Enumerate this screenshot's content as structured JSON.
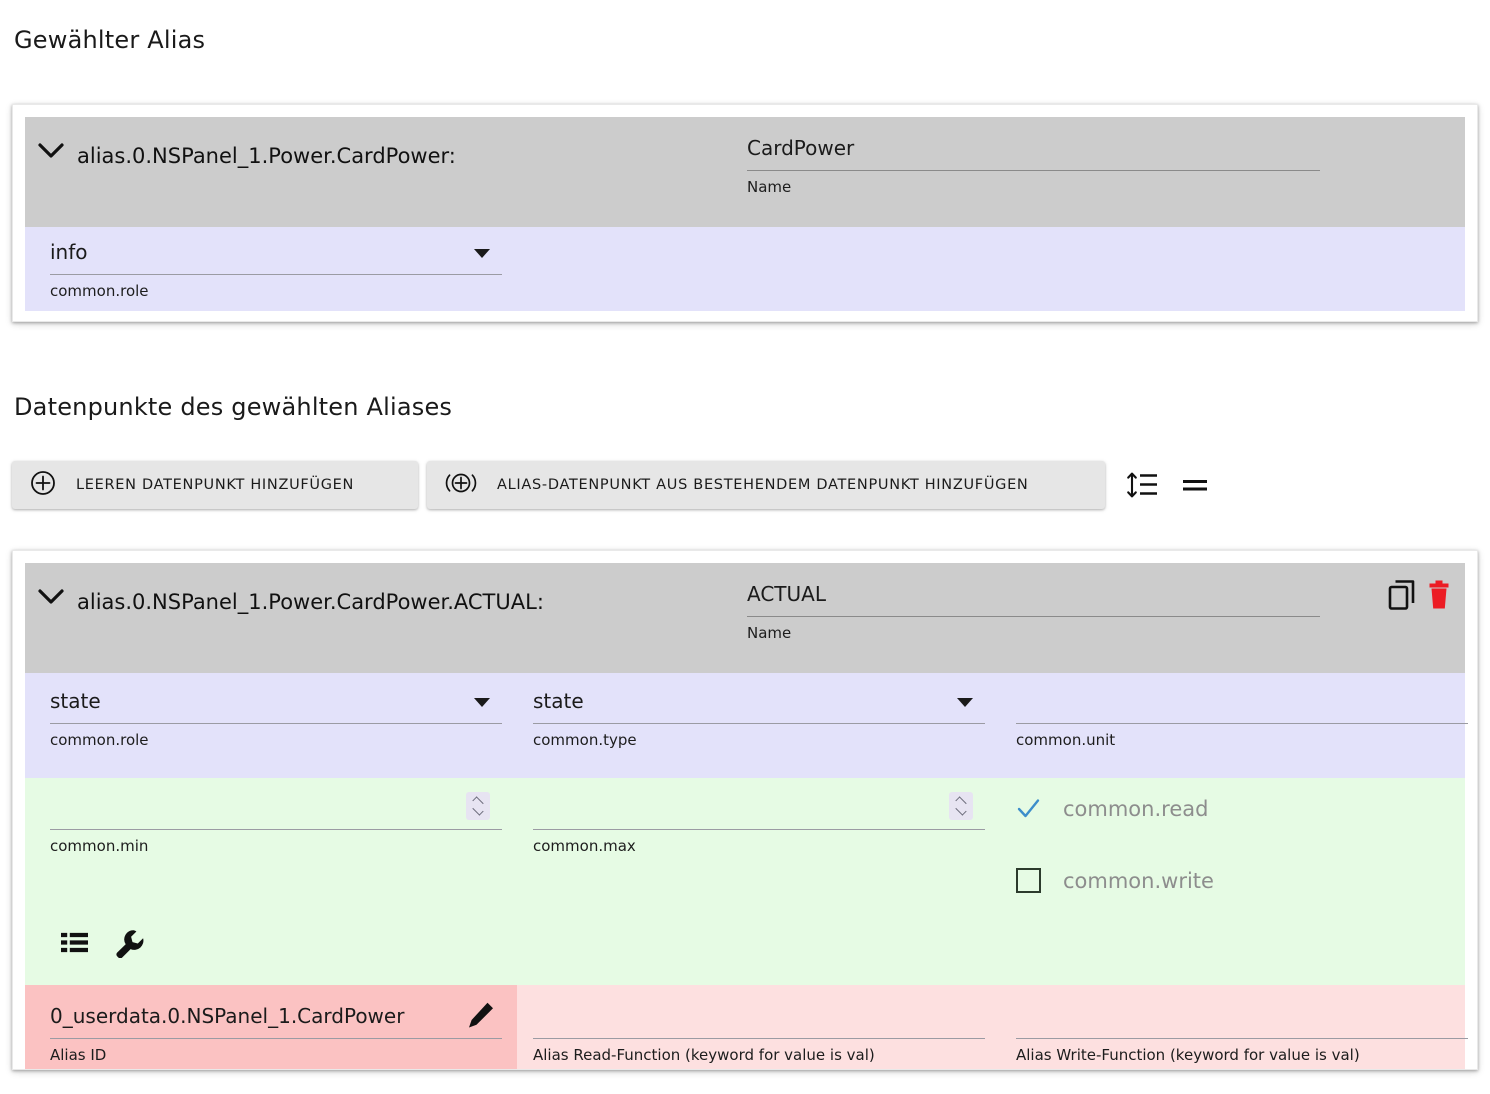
{
  "page": {
    "section_alias_title": "Gewählter Alias",
    "section_datapoints_title": "Datenpunkte des gewählten Aliases"
  },
  "colors": {
    "header_grey": "#cccccc",
    "lavender": "#e3e2fa",
    "green": "#e6fbe4",
    "pink_light": "#fde0e0",
    "pink_dark": "#fbc2c2",
    "check_blue": "#3d8ecb",
    "delete_red": "#ec1c24"
  },
  "alias_card": {
    "chevron_icon": "chevron-down-icon",
    "path": "alias.0.NSPanel_1.Power.CardPower:",
    "name_field": {
      "value": "CardPower",
      "label": "Name"
    },
    "role_field": {
      "value": "info",
      "label": "common.role",
      "caret_icon": "dropdown-caret-icon"
    }
  },
  "toolbar": {
    "add_empty_label": "LEEREN DATENPUNKT HINZUFÜGEN",
    "add_empty_icon": "plus-circle-icon",
    "add_existing_label": "ALIAS-DATENPUNKT AUS BESTEHENDEM DATENPUNKT HINZUFÜGEN",
    "add_existing_icon": "plus-circle-broadcast-icon",
    "sort_icon": "line-height-sort-icon",
    "equals_icon": "equals-icon"
  },
  "datapoint_card": {
    "chevron_icon": "chevron-down-icon",
    "path": "alias.0.NSPanel_1.Power.CardPower.ACTUAL:",
    "name_field": {
      "value": "ACTUAL",
      "label": "Name"
    },
    "copy_icon": "copy-icon",
    "delete_icon": "trash-icon",
    "role_field": {
      "value": "state",
      "label": "common.role",
      "caret_icon": "dropdown-caret-icon"
    },
    "type_field": {
      "value": "state",
      "label": "common.type",
      "caret_icon": "dropdown-caret-icon"
    },
    "unit_field": {
      "value": "",
      "label": "common.unit"
    },
    "min_field": {
      "value": "",
      "label": "common.min",
      "spinner_icon": "number-spinner-icon"
    },
    "max_field": {
      "value": "",
      "label": "common.max",
      "spinner_icon": "number-spinner-icon"
    },
    "read_checkbox": {
      "label": "common.read",
      "checked": true,
      "icon": "check-icon"
    },
    "write_checkbox": {
      "label": "common.write",
      "checked": false,
      "icon": "checkbox-empty-icon"
    },
    "list_icon": "table-list-icon",
    "wrench_icon": "wrench-icon",
    "alias_id_field": {
      "value": "0_userdata.0.NSPanel_1.CardPower",
      "label": "Alias ID",
      "edit_icon": "pencil-icon"
    },
    "read_function_field": {
      "value": "",
      "label": "Alias Read-Function (keyword for value is val)"
    },
    "write_function_field": {
      "value": "",
      "label": "Alias Write-Function (keyword for value is val)"
    }
  }
}
